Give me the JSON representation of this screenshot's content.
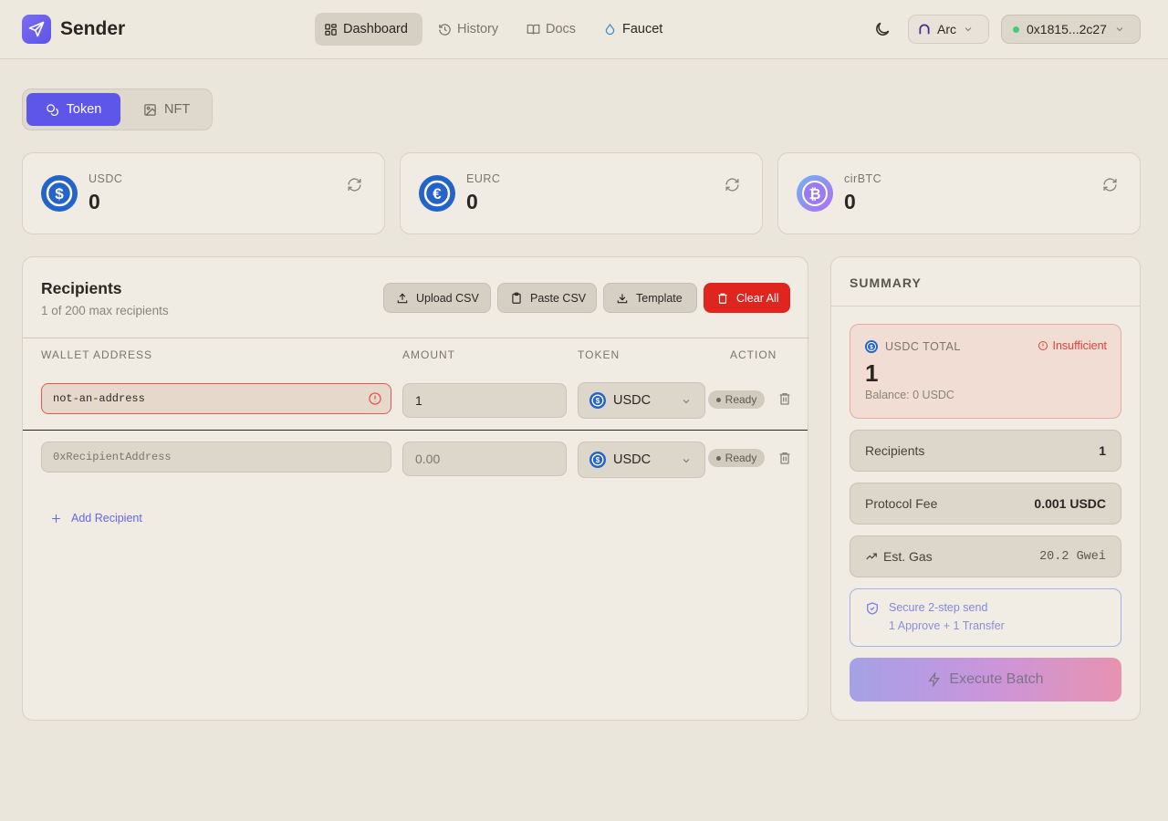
{
  "app": {
    "name": "Sender"
  },
  "nav": {
    "dashboard": "Dashboard",
    "history": "History",
    "docs": "Docs",
    "faucet": "Faucet"
  },
  "chain": {
    "label": "Arc"
  },
  "wallet": {
    "address": "0x1815...2c27",
    "status_color": "#3bd17a"
  },
  "asset_tabs": {
    "token": "Token",
    "nft": "NFT"
  },
  "balances": [
    {
      "symbol": "USDC",
      "amount": "0"
    },
    {
      "symbol": "EURC",
      "amount": "0"
    },
    {
      "symbol": "cirBTC",
      "amount": "0"
    }
  ],
  "recipients": {
    "title": "Recipients",
    "subtitle": "1 of 200 max recipients",
    "buttons": {
      "upload": "Upload CSV",
      "paste": "Paste CSV",
      "template": "Template",
      "clear": "Clear All"
    },
    "headers": {
      "address": "WALLET ADDRESS",
      "amount": "AMOUNT",
      "token": "TOKEN",
      "action": "ACTION"
    },
    "rows": [
      {
        "address": "not-an-address",
        "amount": "1",
        "token": "USDC",
        "status": "Ready"
      },
      {
        "address_placeholder": "0xRecipientAddress",
        "amount_placeholder": "0.00",
        "token": "USDC",
        "status": "Ready"
      }
    ],
    "add_label": "Add Recipient"
  },
  "summary": {
    "title": "SUMMARY",
    "total_label": "USDC TOTAL",
    "total_status": "Insufficient",
    "total_value": "1",
    "balance_text": "Balance: 0 USDC",
    "recipients_label": "Recipients",
    "recipients_value": "1",
    "fee_label": "Protocol Fee",
    "fee_value": "0.001 USDC",
    "gas_label": "Est. Gas",
    "gas_value": "20.2 Gwei",
    "secure_title": "Secure 2-step send",
    "secure_sub": "1 Approve + 1 Transfer",
    "execute_label": "Execute Batch"
  },
  "colors": {
    "accent": "#5d56e8",
    "danger": "#e0251f",
    "usdc": "#2463c8"
  }
}
